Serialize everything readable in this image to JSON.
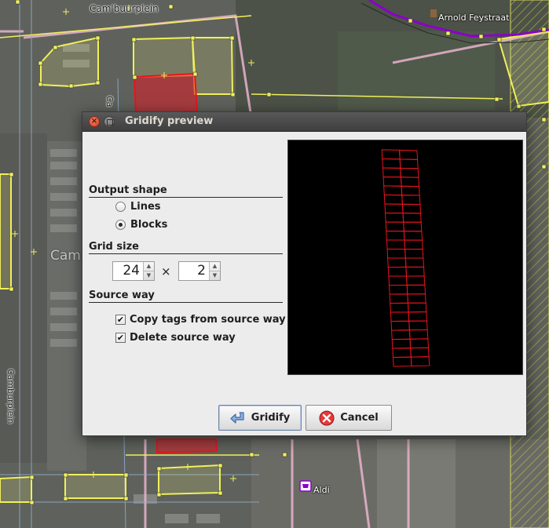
{
  "map": {
    "labels": {
      "camb_top": "Cam'buurplein",
      "arnold": "Arnold Feystraat",
      "aldi": "Aldi",
      "camb_mid": "Cam",
      "camb_left": "Camburplein",
      "ca": "Ca"
    }
  },
  "dialog": {
    "title": "Gridify preview",
    "output_shape": {
      "heading": "Output shape",
      "options": [
        {
          "label": "Lines",
          "selected": false
        },
        {
          "label": "Blocks",
          "selected": true
        }
      ]
    },
    "grid_size": {
      "heading": "Grid size",
      "rows": "24",
      "times": "×",
      "cols": "2"
    },
    "source_way": {
      "heading": "Source way",
      "copy_tags": {
        "label": "Copy tags from source way",
        "checked": true
      },
      "delete_source": {
        "label": "Delete source way",
        "checked": true
      }
    },
    "preview": {
      "rows": 24,
      "cols": 2,
      "stroke_color": "#e8141e",
      "background": "#000000"
    },
    "buttons": {
      "gridify": "Gridify",
      "cancel": "Cancel"
    }
  },
  "colors": {
    "selection_red": "#e8141e",
    "way_yellow": "#f0f05a",
    "building_pink": "#e8b4cc",
    "route_purple": "#8c00c8",
    "titlebar": "#4a4a4a"
  }
}
